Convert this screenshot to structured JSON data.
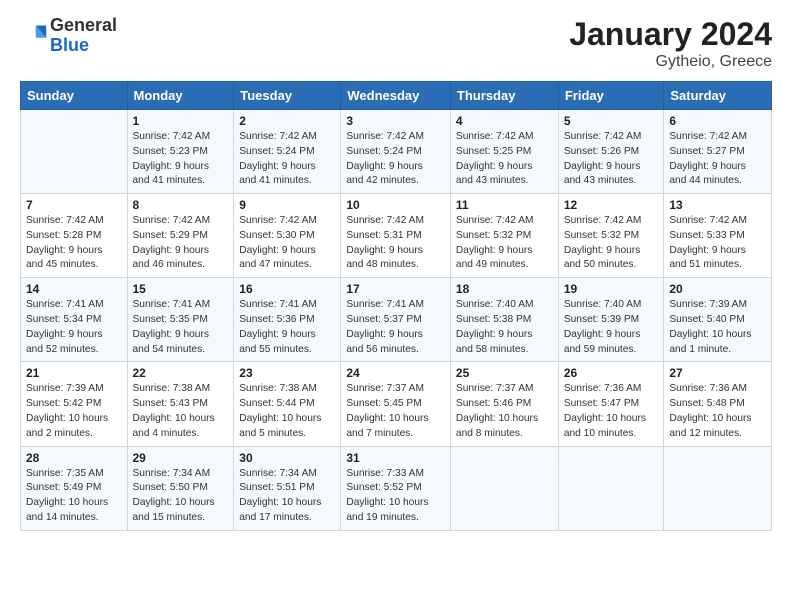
{
  "logo": {
    "general": "General",
    "blue": "Blue"
  },
  "title": "January 2024",
  "subtitle": "Gytheio, Greece",
  "header_days": [
    "Sunday",
    "Monday",
    "Tuesday",
    "Wednesday",
    "Thursday",
    "Friday",
    "Saturday"
  ],
  "weeks": [
    [
      {
        "num": "",
        "detail": ""
      },
      {
        "num": "1",
        "detail": "Sunrise: 7:42 AM\nSunset: 5:23 PM\nDaylight: 9 hours\nand 41 minutes."
      },
      {
        "num": "2",
        "detail": "Sunrise: 7:42 AM\nSunset: 5:24 PM\nDaylight: 9 hours\nand 41 minutes."
      },
      {
        "num": "3",
        "detail": "Sunrise: 7:42 AM\nSunset: 5:24 PM\nDaylight: 9 hours\nand 42 minutes."
      },
      {
        "num": "4",
        "detail": "Sunrise: 7:42 AM\nSunset: 5:25 PM\nDaylight: 9 hours\nand 43 minutes."
      },
      {
        "num": "5",
        "detail": "Sunrise: 7:42 AM\nSunset: 5:26 PM\nDaylight: 9 hours\nand 43 minutes."
      },
      {
        "num": "6",
        "detail": "Sunrise: 7:42 AM\nSunset: 5:27 PM\nDaylight: 9 hours\nand 44 minutes."
      }
    ],
    [
      {
        "num": "7",
        "detail": "Sunrise: 7:42 AM\nSunset: 5:28 PM\nDaylight: 9 hours\nand 45 minutes."
      },
      {
        "num": "8",
        "detail": "Sunrise: 7:42 AM\nSunset: 5:29 PM\nDaylight: 9 hours\nand 46 minutes."
      },
      {
        "num": "9",
        "detail": "Sunrise: 7:42 AM\nSunset: 5:30 PM\nDaylight: 9 hours\nand 47 minutes."
      },
      {
        "num": "10",
        "detail": "Sunrise: 7:42 AM\nSunset: 5:31 PM\nDaylight: 9 hours\nand 48 minutes."
      },
      {
        "num": "11",
        "detail": "Sunrise: 7:42 AM\nSunset: 5:32 PM\nDaylight: 9 hours\nand 49 minutes."
      },
      {
        "num": "12",
        "detail": "Sunrise: 7:42 AM\nSunset: 5:32 PM\nDaylight: 9 hours\nand 50 minutes."
      },
      {
        "num": "13",
        "detail": "Sunrise: 7:42 AM\nSunset: 5:33 PM\nDaylight: 9 hours\nand 51 minutes."
      }
    ],
    [
      {
        "num": "14",
        "detail": "Sunrise: 7:41 AM\nSunset: 5:34 PM\nDaylight: 9 hours\nand 52 minutes."
      },
      {
        "num": "15",
        "detail": "Sunrise: 7:41 AM\nSunset: 5:35 PM\nDaylight: 9 hours\nand 54 minutes."
      },
      {
        "num": "16",
        "detail": "Sunrise: 7:41 AM\nSunset: 5:36 PM\nDaylight: 9 hours\nand 55 minutes."
      },
      {
        "num": "17",
        "detail": "Sunrise: 7:41 AM\nSunset: 5:37 PM\nDaylight: 9 hours\nand 56 minutes."
      },
      {
        "num": "18",
        "detail": "Sunrise: 7:40 AM\nSunset: 5:38 PM\nDaylight: 9 hours\nand 58 minutes."
      },
      {
        "num": "19",
        "detail": "Sunrise: 7:40 AM\nSunset: 5:39 PM\nDaylight: 9 hours\nand 59 minutes."
      },
      {
        "num": "20",
        "detail": "Sunrise: 7:39 AM\nSunset: 5:40 PM\nDaylight: 10 hours\nand 1 minute."
      }
    ],
    [
      {
        "num": "21",
        "detail": "Sunrise: 7:39 AM\nSunset: 5:42 PM\nDaylight: 10 hours\nand 2 minutes."
      },
      {
        "num": "22",
        "detail": "Sunrise: 7:38 AM\nSunset: 5:43 PM\nDaylight: 10 hours\nand 4 minutes."
      },
      {
        "num": "23",
        "detail": "Sunrise: 7:38 AM\nSunset: 5:44 PM\nDaylight: 10 hours\nand 5 minutes."
      },
      {
        "num": "24",
        "detail": "Sunrise: 7:37 AM\nSunset: 5:45 PM\nDaylight: 10 hours\nand 7 minutes."
      },
      {
        "num": "25",
        "detail": "Sunrise: 7:37 AM\nSunset: 5:46 PM\nDaylight: 10 hours\nand 8 minutes."
      },
      {
        "num": "26",
        "detail": "Sunrise: 7:36 AM\nSunset: 5:47 PM\nDaylight: 10 hours\nand 10 minutes."
      },
      {
        "num": "27",
        "detail": "Sunrise: 7:36 AM\nSunset: 5:48 PM\nDaylight: 10 hours\nand 12 minutes."
      }
    ],
    [
      {
        "num": "28",
        "detail": "Sunrise: 7:35 AM\nSunset: 5:49 PM\nDaylight: 10 hours\nand 14 minutes."
      },
      {
        "num": "29",
        "detail": "Sunrise: 7:34 AM\nSunset: 5:50 PM\nDaylight: 10 hours\nand 15 minutes."
      },
      {
        "num": "30",
        "detail": "Sunrise: 7:34 AM\nSunset: 5:51 PM\nDaylight: 10 hours\nand 17 minutes."
      },
      {
        "num": "31",
        "detail": "Sunrise: 7:33 AM\nSunset: 5:52 PM\nDaylight: 10 hours\nand 19 minutes."
      },
      {
        "num": "",
        "detail": ""
      },
      {
        "num": "",
        "detail": ""
      },
      {
        "num": "",
        "detail": ""
      }
    ]
  ]
}
